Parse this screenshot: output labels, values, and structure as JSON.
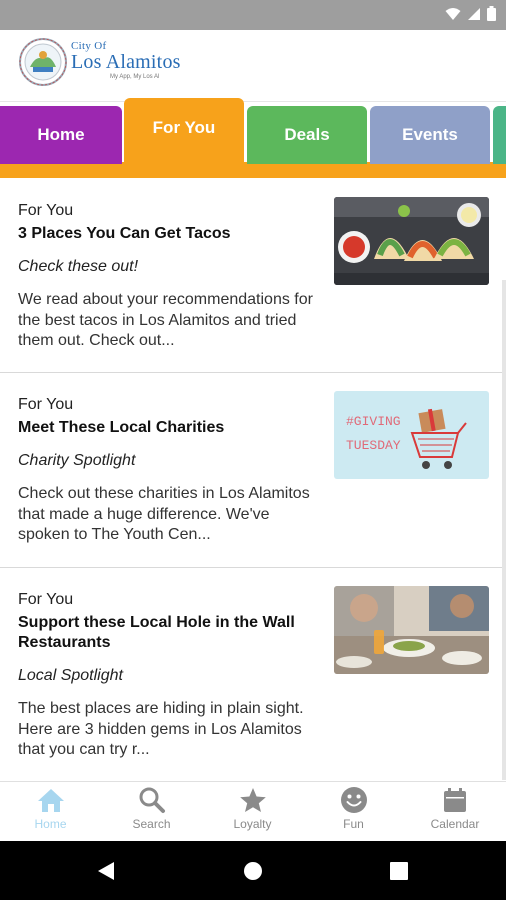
{
  "colors": {
    "status_bar": "#9e9e9e",
    "brand_blue": "#2a6db5",
    "tab_home": "#9c27b0",
    "tab_for_you": "#f7a21b",
    "tab_deals": "#5cb85c",
    "tab_events": "#8fa0c8",
    "tab_extra": "#4bb587",
    "nav_active": "#a7d6ef",
    "nav_inactive": "#8a8a8a"
  },
  "logo": {
    "line1": "City Of",
    "line2": "Los Alamitos",
    "tagline": "My App, My Los Al"
  },
  "tabs": [
    {
      "label": "Home",
      "icon": "none"
    },
    {
      "label": "For You",
      "active": true
    },
    {
      "label": "Deals"
    },
    {
      "label": "Events"
    },
    {
      "label": ""
    }
  ],
  "cards": [
    {
      "category": "For You",
      "title": "3 Places You Can Get Tacos",
      "subtitle": "Check these out!",
      "description": "We read about your recommendations for the best tacos in Los Alamitos and tried them out.  Check out...",
      "image_icon": "tacos-photo"
    },
    {
      "category": "For You",
      "title": "Meet These Local Charities",
      "subtitle": "Charity Spotlight",
      "description": "Check out these charities in Los Alamitos that made a huge difference. We've spoken to The Youth Cen...",
      "image_text1": "#GIVING",
      "image_text2": "TUESDAY",
      "image_icon": "giving-tuesday-cart-photo"
    },
    {
      "category": "For You",
      "title": "Support these Local Hole in the Wall Restaurants",
      "subtitle": "Local Spotlight",
      "description": "The best places are hiding in plain sight. Here are 3 hidden gems in Los Alamitos that you can try r...",
      "image_icon": "restaurant-dining-photo"
    }
  ],
  "bottom_nav": [
    {
      "label": "Home",
      "icon": "home-icon",
      "active": true
    },
    {
      "label": "Search",
      "icon": "search-icon"
    },
    {
      "label": "Loyalty",
      "icon": "star-icon"
    },
    {
      "label": "Fun",
      "icon": "smiley-icon"
    },
    {
      "label": "Calendar",
      "icon": "calendar-icon"
    }
  ]
}
